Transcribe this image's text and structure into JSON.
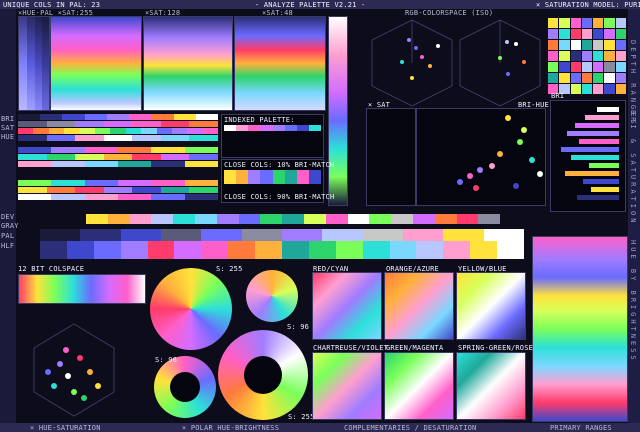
{
  "header": {
    "left": "UNIQUE COLS IN PAL: 23",
    "title": "- ANALYZE PALETTE V2.21 -",
    "right": "× SATURATION MODEL: PURISM"
  },
  "subheader": {
    "hue": "×HUE-PAL ×SAT:255",
    "sat128": "×SAT:128",
    "sat48": "×SAT:48",
    "rgbspace": "RGB-COLORSPACE (ISO)"
  },
  "left_tags": [
    "BRI",
    "SAT",
    "HUE",
    "DEV",
    "GRAY",
    "PAL",
    "HLF"
  ],
  "indexed": {
    "title": "INDEXED PALETTE:",
    "close_bri": "CLOSE COLS: 10% BRI-MATCH",
    "close_sat": "CLOSE COLS: 90% BRI-MATCH"
  },
  "scatter": {
    "sat_label": "× SAT",
    "bri_hue": "BRI-HUE",
    "bri": "BRI"
  },
  "right_vtext_top": "DEPTH RANGES",
  "right_vtext_mid": "BRI & SATURATION",
  "right_vtext_bot": "HUE BY BRIGHTNESS",
  "colspace_title": "12 BIT COLSPACE",
  "polar": {
    "s255a": "S: 255",
    "s96a": "S: 96",
    "s96b": "S: 96",
    "s255b": "S: 255"
  },
  "quad_titles": [
    "RED/CYAN",
    "ORANGE/AZURE",
    "YELLOW/BLUE",
    "CHARTREUSE/VIOLET",
    "GREEN/MAGENTA",
    "SPRING-GREEN/ROSE"
  ],
  "footer": {
    "hue_sat": "× HUE-SATURATION",
    "polar": "× POLAR HUE-BRIGHTNESS",
    "compl": "COMPLEMENTARIES / DESATURATION",
    "primary": "PRIMARY RANGES"
  },
  "palette": [
    "#1a1a3a",
    "#2b2f77",
    "#3f48cc",
    "#6b6bff",
    "#a07cff",
    "#d46cff",
    "#ff5fc8",
    "#ff3b6b",
    "#ff7a3b",
    "#ffb13b",
    "#ffe23b",
    "#d8ff5a",
    "#7aff5a",
    "#2cd46b",
    "#1fa89a",
    "#2ce0d8",
    "#7ad8ff",
    "#b8c8ff",
    "#ffffff",
    "#c8c8c8",
    "#8a8aa0",
    "#5a5a7a",
    "#ff9fd0"
  ]
}
